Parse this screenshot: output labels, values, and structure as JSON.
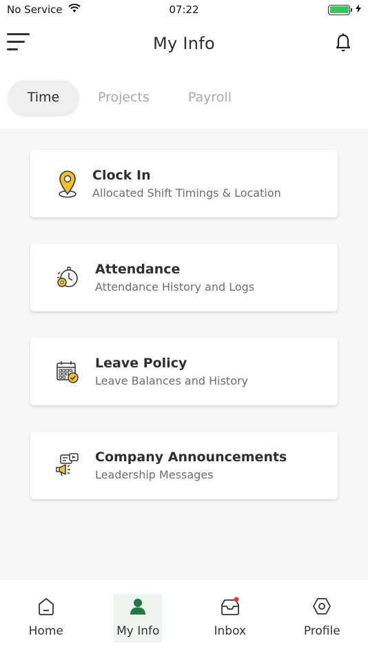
{
  "status_bar": {
    "carrier": "No Service",
    "time": "07:22"
  },
  "header": {
    "title": "My Info"
  },
  "tabs": [
    {
      "label": "Time",
      "active": true
    },
    {
      "label": "Projects",
      "active": false
    },
    {
      "label": "Payroll",
      "active": false
    }
  ],
  "cards": [
    {
      "title": "Clock In",
      "subtitle": "Allocated Shift Timings & Location",
      "icon": "location-pin-icon"
    },
    {
      "title": "Attendance",
      "subtitle": "Attendance History and Logs",
      "icon": "stopwatch-icon"
    },
    {
      "title": "Leave Policy",
      "subtitle": "Leave Balances and History",
      "icon": "calendar-check-icon"
    },
    {
      "title": "Company Announcements",
      "subtitle": "Leadership Messages",
      "icon": "megaphone-icon"
    }
  ],
  "bottom_nav": [
    {
      "label": "Home",
      "icon": "home-icon",
      "active": false
    },
    {
      "label": "My Info",
      "icon": "person-icon",
      "active": true
    },
    {
      "label": "Inbox",
      "icon": "inbox-icon",
      "active": false
    },
    {
      "label": "Profile",
      "icon": "hexagon-icon",
      "active": false
    }
  ],
  "colors": {
    "accent_yellow": "#f2c12e",
    "accent_green": "#1e7a45",
    "notification_red": "#e53935",
    "battery_green": "#34c759"
  }
}
